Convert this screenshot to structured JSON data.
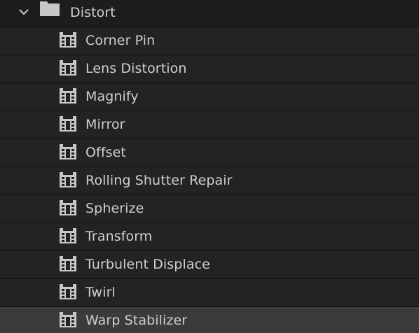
{
  "folder": {
    "label": "Distort",
    "expanded": true,
    "icon": "folder-icon",
    "toggle_icon": "chevron-down-icon"
  },
  "effects": [
    {
      "label": "Corner Pin",
      "icon": "effect-icon",
      "selected": false
    },
    {
      "label": "Lens Distortion",
      "icon": "effect-icon",
      "selected": false
    },
    {
      "label": "Magnify",
      "icon": "effect-icon",
      "selected": false
    },
    {
      "label": "Mirror",
      "icon": "effect-icon",
      "selected": false
    },
    {
      "label": "Offset",
      "icon": "effect-icon",
      "selected": false
    },
    {
      "label": "Rolling Shutter Repair",
      "icon": "effect-icon",
      "selected": false
    },
    {
      "label": "Spherize",
      "icon": "effect-icon",
      "selected": false
    },
    {
      "label": "Transform",
      "icon": "effect-icon",
      "selected": false
    },
    {
      "label": "Turbulent Displace",
      "icon": "effect-icon",
      "selected": false
    },
    {
      "label": "Twirl",
      "icon": "effect-icon",
      "selected": false
    },
    {
      "label": "Warp Stabilizer",
      "icon": "effect-icon",
      "selected": true
    }
  ],
  "colors": {
    "background": "#1d1d1d",
    "row": "#232323",
    "selected_row": "#3b3b3b",
    "text": "#cfcfcf",
    "icon": "#c8c8c8"
  }
}
